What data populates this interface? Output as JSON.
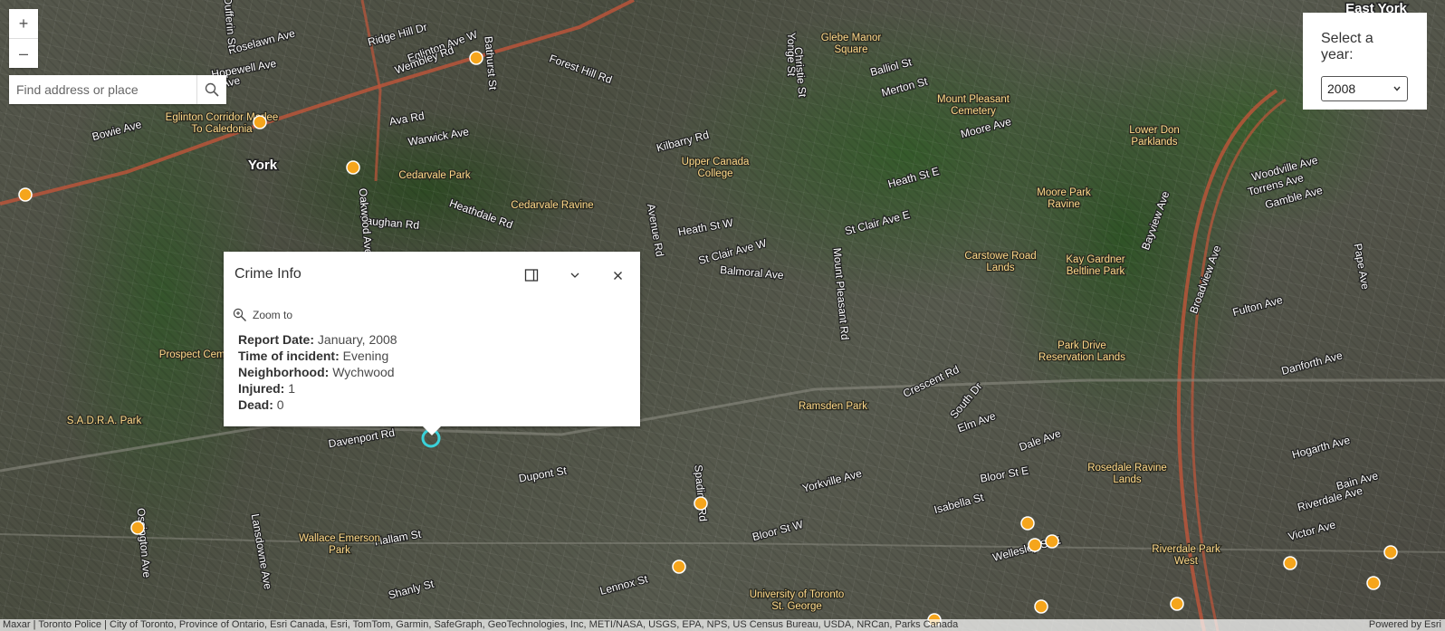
{
  "zoom": {
    "in_label": "+",
    "out_label": "–"
  },
  "search": {
    "placeholder": "Find address or place"
  },
  "year_widget": {
    "title": "Select a year:",
    "selected": "2008"
  },
  "popup": {
    "title": "Crime Info",
    "zoom_to": "Zoom to",
    "fields": [
      {
        "label": "Report Date:",
        "value": "January, 2008"
      },
      {
        "label": "Time of incident:",
        "value": "Evening"
      },
      {
        "label": "Neighborhood:",
        "value": "Wychwood"
      },
      {
        "label": "Injured:",
        "value": "1"
      },
      {
        "label": "Dead:",
        "value": "0"
      }
    ]
  },
  "attribution": {
    "sources": "Maxar | Toronto Police | City of Toronto, Province of Ontario, Esri Canada, Esri, TomTom, Garmin, SafeGraph, GeoTechnologies, Inc, METI/NASA, USGS, EPA, NPS, US Census Bureau, USDA, NRCan, Parks Canada",
    "powered_by": "Powered by Esri"
  },
  "map_labels": {
    "streets": [
      "Eglinton Ave W",
      "Ridge Hill Dr",
      "Wembley Rd",
      "Roselawn Ave",
      "Hopewell Ave",
      "Belgravia Ave",
      "Bowie Ave",
      "Ava Rd",
      "Warwick Ave",
      "Forest Hill Rd",
      "Kilbarry Rd",
      "Heathdale Rd",
      "Vaughan Rd",
      "St Clair Ave W",
      "Balmoral Ave",
      "Heath St W",
      "Merton St",
      "Balliol St",
      "Moore Ave",
      "Heath St E",
      "St Clair Ave E",
      "Crescent Rd",
      "South Dr",
      "Elm Ave",
      "Dale Ave",
      "Bloor St E",
      "Davenport Rd",
      "Dupont St",
      "Bloor St W",
      "Yorkville Ave",
      "Isabella St",
      "Wellesley St E",
      "Hallam St",
      "Shanly St",
      "Lennox St",
      "Hogarth Ave",
      "Bain Ave",
      "Riverdale Ave",
      "Victor Ave",
      "Danforth Ave",
      "Fulton Ave",
      "Gamble Ave",
      "Torrens Ave",
      "Woodville Ave",
      "Yonge St",
      "Bathurst St",
      "Spadina Rd",
      "Avenue Rd",
      "Mount Pleasant Rd",
      "Bayview Ave",
      "Broadview Ave",
      "Pape Ave",
      "Oakwood Ave",
      "Dufferin St",
      "Lansdowne Ave",
      "Christie St",
      "Ossington Ave"
    ],
    "places": [
      "Glebe Manor Square",
      "Mount Pleasant Cemetery",
      "Lower Don Parklands",
      "Eglinton Corridor Marlee To Caledonia",
      "Cedarvale Park",
      "Cedarvale Ravine",
      "Upper Canada College",
      "Moore Park Ravine",
      "Carstowe Road Lands",
      "Kay Gardner Beltline Park",
      "Park Drive Reservation Lands",
      "Ramsden Park",
      "Rosedale Ravine Lands",
      "Prospect Cemetery",
      "S.A.D.R.A. Park",
      "Wallace Emerson Park",
      "University of Toronto St. George",
      "Riverdale Park West"
    ],
    "districts": [
      "York",
      "East York"
    ]
  }
}
